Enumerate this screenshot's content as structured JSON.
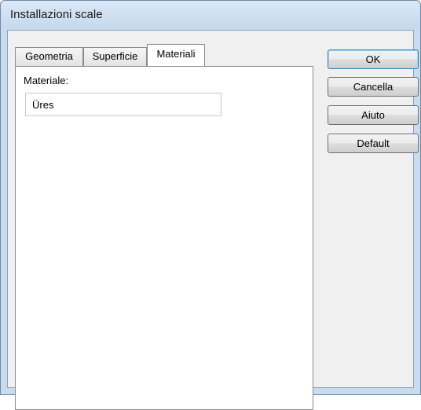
{
  "window": {
    "title": "Installazioni scale"
  },
  "tabs": [
    {
      "label": "Geometria",
      "active": false
    },
    {
      "label": "Superficie",
      "active": false
    },
    {
      "label": "Materiali",
      "active": true
    }
  ],
  "materiali": {
    "label": "Materiale:",
    "value": "Üres"
  },
  "buttons": {
    "ok": "OK",
    "cancel": "Cancella",
    "help": "Aiuto",
    "default": "Default"
  }
}
